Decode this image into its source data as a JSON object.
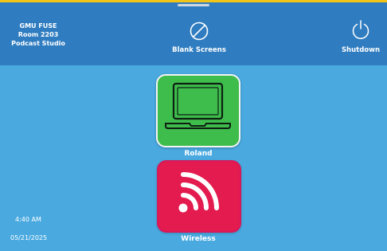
{
  "header": {
    "room_lines": [
      "GMU FUSE",
      "Room 2203",
      "Podcast Studio"
    ],
    "blank_screens_label": "Blank Screens",
    "shutdown_label": "Shutdown"
  },
  "sources": [
    {
      "label": "Roland",
      "icon": "laptop-icon",
      "color": "#3ebd4c"
    },
    {
      "label": "Wireless",
      "icon": "wifi-icon",
      "color": "#e41b4f"
    }
  ],
  "status": {
    "time": "4:40 AM",
    "date": "05/21/2025"
  },
  "colors": {
    "background": "#4aaae0",
    "header": "#2f7dc0",
    "accent": "#f2c418"
  }
}
